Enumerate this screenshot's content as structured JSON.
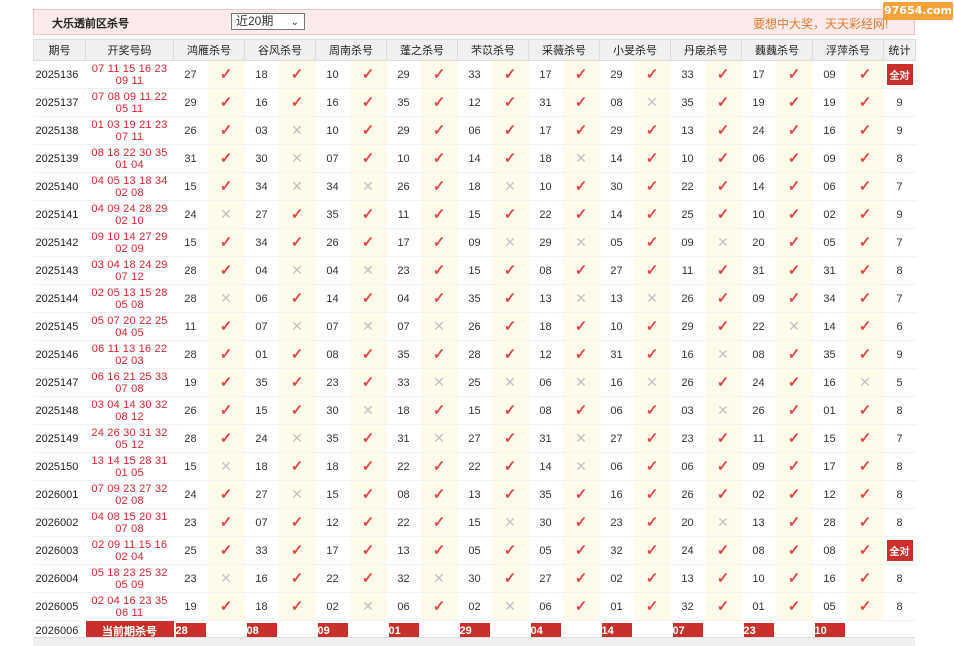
{
  "header": {
    "title": "大乐透前区杀号",
    "range_select": "近20期",
    "slogan": "要想中大奖，天天彩经网!",
    "logo": "97654.com"
  },
  "columns": {
    "period": "期号",
    "draw": "开奖号码",
    "experts": [
      "鸿雁杀号",
      "谷风杀号",
      "周南杀号",
      "蓬之杀号",
      "芣苡杀号",
      "采薇杀号",
      "小旻杀号",
      "丹扆杀号",
      "蘶蘶杀号",
      "浮萍杀号"
    ],
    "stats": "统计"
  },
  "rows": [
    {
      "period": "2025136",
      "front": "07 11 15 16 23",
      "back": "09 11",
      "kills": [
        "27",
        "18",
        "10",
        "29",
        "33",
        "17",
        "29",
        "33",
        "17",
        "09"
      ],
      "hits": [
        1,
        1,
        1,
        1,
        1,
        1,
        1,
        1,
        1,
        1
      ],
      "stat": "全对"
    },
    {
      "period": "2025137",
      "front": "07 08 09 11 22",
      "back": "05 11",
      "kills": [
        "29",
        "16",
        "16",
        "35",
        "12",
        "31",
        "08",
        "35",
        "19",
        "19"
      ],
      "hits": [
        1,
        1,
        1,
        1,
        1,
        1,
        0,
        1,
        1,
        1
      ],
      "stat": "9"
    },
    {
      "period": "2025138",
      "front": "01 03 19 21 23",
      "back": "07 11",
      "kills": [
        "26",
        "03",
        "10",
        "29",
        "06",
        "17",
        "29",
        "13",
        "24",
        "16"
      ],
      "hits": [
        1,
        0,
        1,
        1,
        1,
        1,
        1,
        1,
        1,
        1
      ],
      "stat": "9"
    },
    {
      "period": "2025139",
      "front": "08 18 22 30 35",
      "back": "01 04",
      "kills": [
        "31",
        "30",
        "07",
        "10",
        "14",
        "18",
        "14",
        "10",
        "06",
        "09"
      ],
      "hits": [
        1,
        0,
        1,
        1,
        1,
        0,
        1,
        1,
        1,
        1
      ],
      "stat": "8"
    },
    {
      "period": "2025140",
      "front": "04 05 13 18 34",
      "back": "02 08",
      "kills": [
        "15",
        "34",
        "34",
        "26",
        "18",
        "10",
        "30",
        "22",
        "14",
        "06"
      ],
      "hits": [
        1,
        0,
        0,
        1,
        0,
        1,
        1,
        1,
        1,
        1
      ],
      "stat": "7"
    },
    {
      "period": "2025141",
      "front": "04 09 24 28 29",
      "back": "02 10",
      "kills": [
        "24",
        "27",
        "35",
        "11",
        "15",
        "22",
        "14",
        "25",
        "10",
        "02"
      ],
      "hits": [
        0,
        1,
        1,
        1,
        1,
        1,
        1,
        1,
        1,
        1
      ],
      "stat": "9"
    },
    {
      "period": "2025142",
      "front": "09 10 14 27 29",
      "back": "02 09",
      "kills": [
        "15",
        "34",
        "26",
        "17",
        "09",
        "29",
        "05",
        "09",
        "20",
        "05"
      ],
      "hits": [
        1,
        1,
        1,
        1,
        0,
        0,
        1,
        0,
        1,
        1
      ],
      "stat": "7"
    },
    {
      "period": "2025143",
      "front": "03 04 18 24 29",
      "back": "07 12",
      "kills": [
        "28",
        "04",
        "04",
        "23",
        "15",
        "08",
        "27",
        "11",
        "31",
        "31"
      ],
      "hits": [
        1,
        0,
        0,
        1,
        1,
        1,
        1,
        1,
        1,
        1
      ],
      "stat": "8"
    },
    {
      "period": "2025144",
      "front": "02 05 13 15 28",
      "back": "05 08",
      "kills": [
        "28",
        "06",
        "14",
        "04",
        "35",
        "13",
        "13",
        "26",
        "09",
        "34"
      ],
      "hits": [
        0,
        1,
        1,
        1,
        1,
        0,
        0,
        1,
        1,
        1
      ],
      "stat": "7"
    },
    {
      "period": "2025145",
      "front": "05 07 20 22 25",
      "back": "04 05",
      "kills": [
        "11",
        "07",
        "07",
        "07",
        "26",
        "18",
        "10",
        "29",
        "22",
        "14"
      ],
      "hits": [
        1,
        0,
        0,
        0,
        1,
        1,
        1,
        1,
        0,
        1
      ],
      "stat": "6"
    },
    {
      "period": "2025146",
      "front": "06 11 13 16 22",
      "back": "02 03",
      "kills": [
        "28",
        "01",
        "08",
        "35",
        "28",
        "12",
        "31",
        "16",
        "08",
        "35"
      ],
      "hits": [
        1,
        1,
        1,
        1,
        1,
        1,
        1,
        0,
        1,
        1
      ],
      "stat": "9"
    },
    {
      "period": "2025147",
      "front": "06 16 21 25 33",
      "back": "07 08",
      "kills": [
        "19",
        "35",
        "23",
        "33",
        "25",
        "06",
        "16",
        "26",
        "24",
        "16"
      ],
      "hits": [
        1,
        1,
        1,
        0,
        0,
        0,
        0,
        1,
        1,
        0
      ],
      "stat": "5"
    },
    {
      "period": "2025148",
      "front": "03 04 14 30 32",
      "back": "08 12",
      "kills": [
        "26",
        "15",
        "30",
        "18",
        "15",
        "08",
        "06",
        "03",
        "26",
        "01"
      ],
      "hits": [
        1,
        1,
        0,
        1,
        1,
        1,
        1,
        0,
        1,
        1
      ],
      "stat": "8"
    },
    {
      "period": "2025149",
      "front": "24 26 30 31 32",
      "back": "05 12",
      "kills": [
        "28",
        "24",
        "35",
        "31",
        "27",
        "31",
        "27",
        "23",
        "11",
        "15"
      ],
      "hits": [
        1,
        0,
        1,
        0,
        1,
        0,
        1,
        1,
        1,
        1
      ],
      "stat": "7"
    },
    {
      "period": "2025150",
      "front": "13 14 15 28 31",
      "back": "01 05",
      "kills": [
        "15",
        "18",
        "18",
        "22",
        "22",
        "14",
        "06",
        "06",
        "09",
        "17"
      ],
      "hits": [
        0,
        1,
        1,
        1,
        1,
        0,
        1,
        1,
        1,
        1
      ],
      "stat": "8"
    },
    {
      "period": "2026001",
      "front": "07 09 23 27 32",
      "back": "02 08",
      "kills": [
        "24",
        "27",
        "15",
        "08",
        "13",
        "35",
        "16",
        "26",
        "02",
        "12"
      ],
      "hits": [
        1,
        0,
        1,
        1,
        1,
        1,
        1,
        1,
        1,
        1
      ],
      "stat": "8"
    },
    {
      "period": "2026002",
      "front": "04 08 15 20 31",
      "back": "07 08",
      "kills": [
        "23",
        "07",
        "12",
        "22",
        "15",
        "30",
        "23",
        "20",
        "13",
        "28"
      ],
      "hits": [
        1,
        1,
        1,
        1,
        0,
        1,
        1,
        0,
        1,
        1
      ],
      "stat": "8"
    },
    {
      "period": "2026003",
      "front": "02 09 11 15 16",
      "back": "02 04",
      "kills": [
        "25",
        "33",
        "17",
        "13",
        "05",
        "05",
        "32",
        "24",
        "08",
        "08"
      ],
      "hits": [
        1,
        1,
        1,
        1,
        1,
        1,
        1,
        1,
        1,
        1
      ],
      "stat": "全对"
    },
    {
      "period": "2026004",
      "front": "05 18 23 25 32",
      "back": "05 09",
      "kills": [
        "23",
        "16",
        "22",
        "32",
        "30",
        "27",
        "02",
        "13",
        "10",
        "16"
      ],
      "hits": [
        0,
        1,
        1,
        0,
        1,
        1,
        1,
        1,
        1,
        1
      ],
      "stat": "8"
    },
    {
      "period": "2026005",
      "front": "02 04 16 23 35",
      "back": "06 11",
      "kills": [
        "19",
        "18",
        "02",
        "06",
        "02",
        "06",
        "01",
        "32",
        "01",
        "05"
      ],
      "hits": [
        1,
        1,
        0,
        1,
        0,
        1,
        1,
        1,
        1,
        1
      ],
      "stat": "8"
    }
  ],
  "current": {
    "period": "2026006",
    "label": "当前期杀号",
    "kills": [
      "28",
      "08",
      "09",
      "01",
      "29",
      "04",
      "14",
      "07",
      "23",
      "10"
    ]
  },
  "colors": {
    "accent": "#c9302c",
    "draw_text": "#d6262c",
    "check": "#e04a4a",
    "cross": "#c2c2c2",
    "stripe": "#fffbea"
  }
}
